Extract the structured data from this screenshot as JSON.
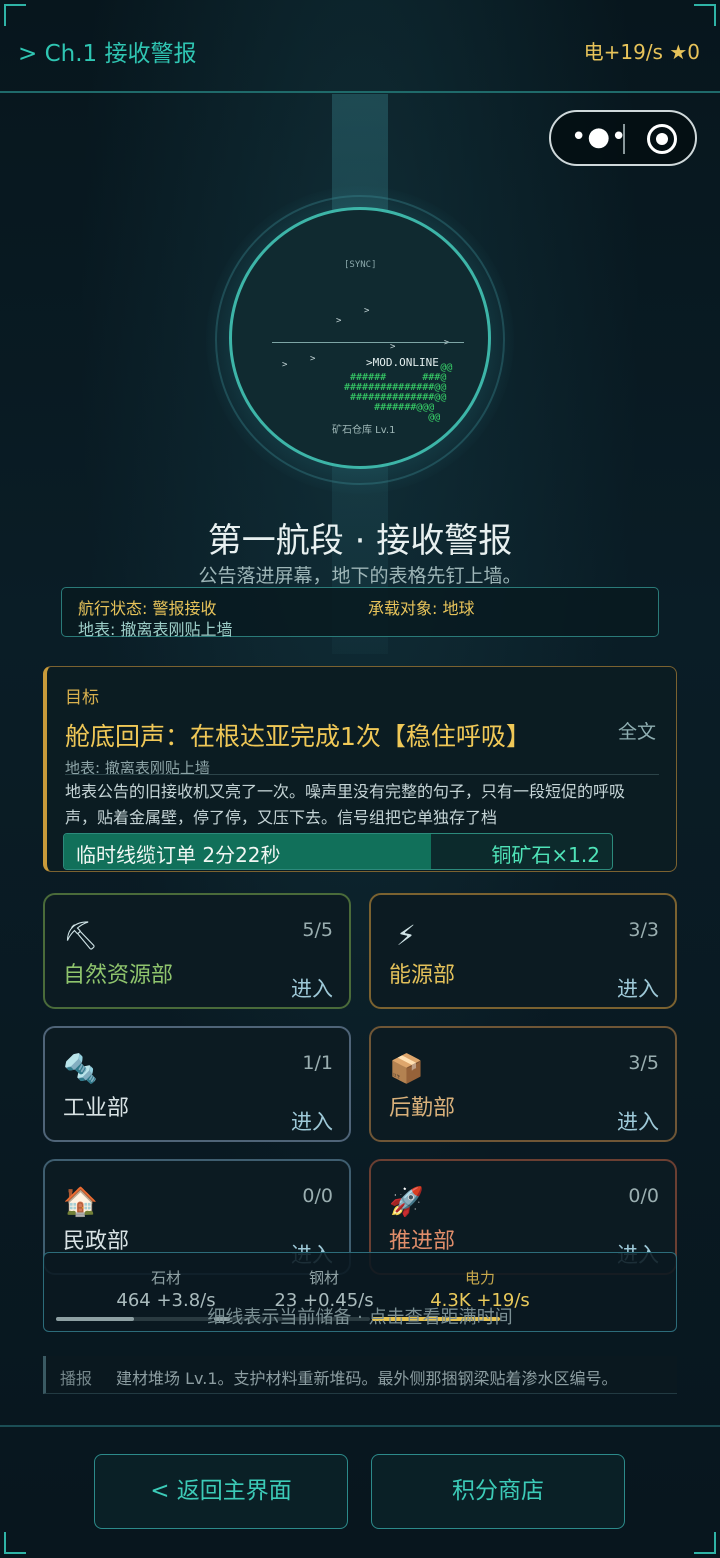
{
  "topbar": {
    "chapter": "> Ch.1 接收警报",
    "resource": "电+19/s ★0"
  },
  "capsule": {
    "more_glyph": "•●•"
  },
  "radar": {
    "sync": "[SYNC]",
    "glyph": ">",
    "status": ">MOD.ONLINE",
    "ascii": "                @@\n ######      ###@\n###############@@\n ##############@@\n     #######@@@\n              @@",
    "depot": "矿石仓库 Lv.1"
  },
  "title": "第一航段 · 接收警报",
  "subtitle": "公告落进屏幕，地下的表格先钉上墙。",
  "info": {
    "nav_status": "航行状态: 警报接收",
    "carry_target": "承载对象: 地球",
    "surface": "地表: 撤离表刚贴上墙"
  },
  "goal": {
    "label": "目标",
    "headline": "舱底回声：在根达亚完成1次【稳住呼吸】",
    "full_text": "全文",
    "surface": "地表: 撤离表刚贴上墙",
    "body": "地表公告的旧接收机又亮了一次。噪声里没有完整的句子，只有一段短促的呼吸声，贴着金属壁，停了停，又压下去。信号组把它单独存了档",
    "order": "临时线缆订单  2分22秒",
    "reward": "铜矿石×1.2",
    "progress": 0.67
  },
  "departments": [
    {
      "icon": "⛏",
      "icon_name": "pickaxe-icon",
      "name": "自然资源部",
      "count": "5/5",
      "enter": "进入",
      "color": "#8fc46d",
      "border": "#4a6b3a"
    },
    {
      "icon": "⚡",
      "icon_name": "lightning-icon",
      "name": "能源部",
      "count": "3/3",
      "enter": "进入",
      "color": "#e2c05a",
      "border": "#7b6230"
    },
    {
      "icon": "🔩",
      "icon_name": "bolt-icon",
      "name": "工业部",
      "count": "1/1",
      "enter": "进入",
      "color": "#d8e2e4",
      "border": "#4f6478"
    },
    {
      "icon": "📦",
      "icon_name": "package-icon",
      "name": "后勤部",
      "count": "3/5",
      "enter": "进入",
      "color": "#d8b07a",
      "border": "#6f5636"
    },
    {
      "icon": "🏠",
      "icon_name": "house-icon",
      "name": "民政部",
      "count": "0/0",
      "enter": "进入",
      "color": "#d8e2e4",
      "border": "#3f5e70"
    },
    {
      "icon": "🚀",
      "icon_name": "rocket-icon",
      "name": "推进部",
      "count": "0/0",
      "enter": "进入",
      "color": "#e08d6a",
      "border": "#6b3f32"
    }
  ],
  "resources": [
    {
      "label": "石材",
      "value": "464 +3.8/s",
      "fill": 0.5,
      "color": "#8ea0a3"
    },
    {
      "label": "钢材",
      "value": "23 +0.45/s",
      "fill": 0.1,
      "color": "#8ea0a3"
    },
    {
      "label": "电力",
      "value": "4.3K +19/s",
      "fill": 1.0,
      "color": "#e6c34f"
    }
  ],
  "resource_hint": "细线表示当前储备 · 点击查看距满时间",
  "broadcast": {
    "label": "播报",
    "text": "建材堆场 Lv.1。支护材料重新堆码。最外侧那捆钢梁贴着渗水区编号。"
  },
  "buttons": {
    "back": "< 返回主界面",
    "shop": "积分商店"
  }
}
